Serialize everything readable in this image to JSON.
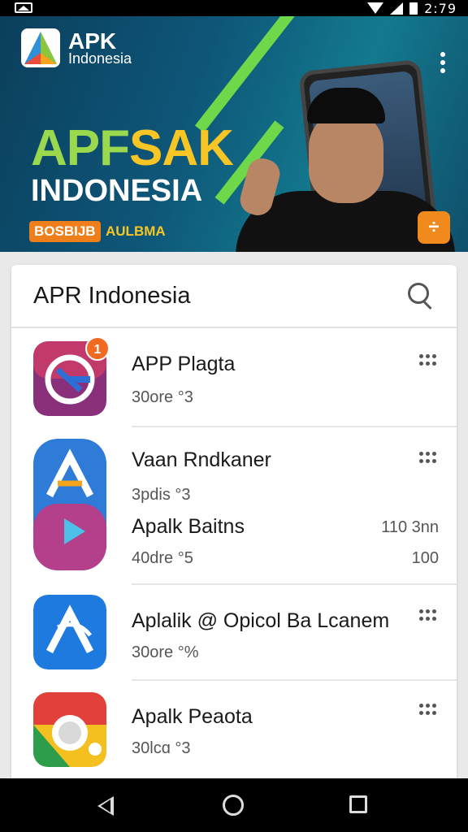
{
  "status_bar": {
    "time": "2:79"
  },
  "hero": {
    "logo_apk": "APK",
    "logo_sub": "Indonesia",
    "title_part1": "APF",
    "title_part2": "SAK",
    "title_line2": "INDONESIA",
    "pill_text": "BOSBIJB",
    "pill_suffix": "AULBMA",
    "badge_symbol": "÷",
    "colors": {
      "title_green": "#9ad84e",
      "title_yellow": "#f7c624",
      "pill": "#ef7f1a"
    }
  },
  "list": {
    "title": "APR Indonesia",
    "search_icon": "search-icon",
    "apps": [
      {
        "name": "APP Plagta",
        "meta": "30ore °3",
        "badge": "1"
      },
      {
        "name": "Vaan Rndkaner",
        "meta": "3pdis °3"
      },
      {
        "name": "Apalk Baitns",
        "meta": "40dre °5",
        "extra_top": "110 3nn",
        "extra_bottom": "100"
      },
      {
        "name": "Aplalik @ Opicol Ba Lcanem",
        "meta": "30ore °%"
      },
      {
        "name": "Apalk Peaota",
        "meta": "30lcɑ °3"
      }
    ]
  },
  "nav_bar": {
    "back": "back-icon",
    "home": "home-icon",
    "recents": "recents-icon"
  }
}
